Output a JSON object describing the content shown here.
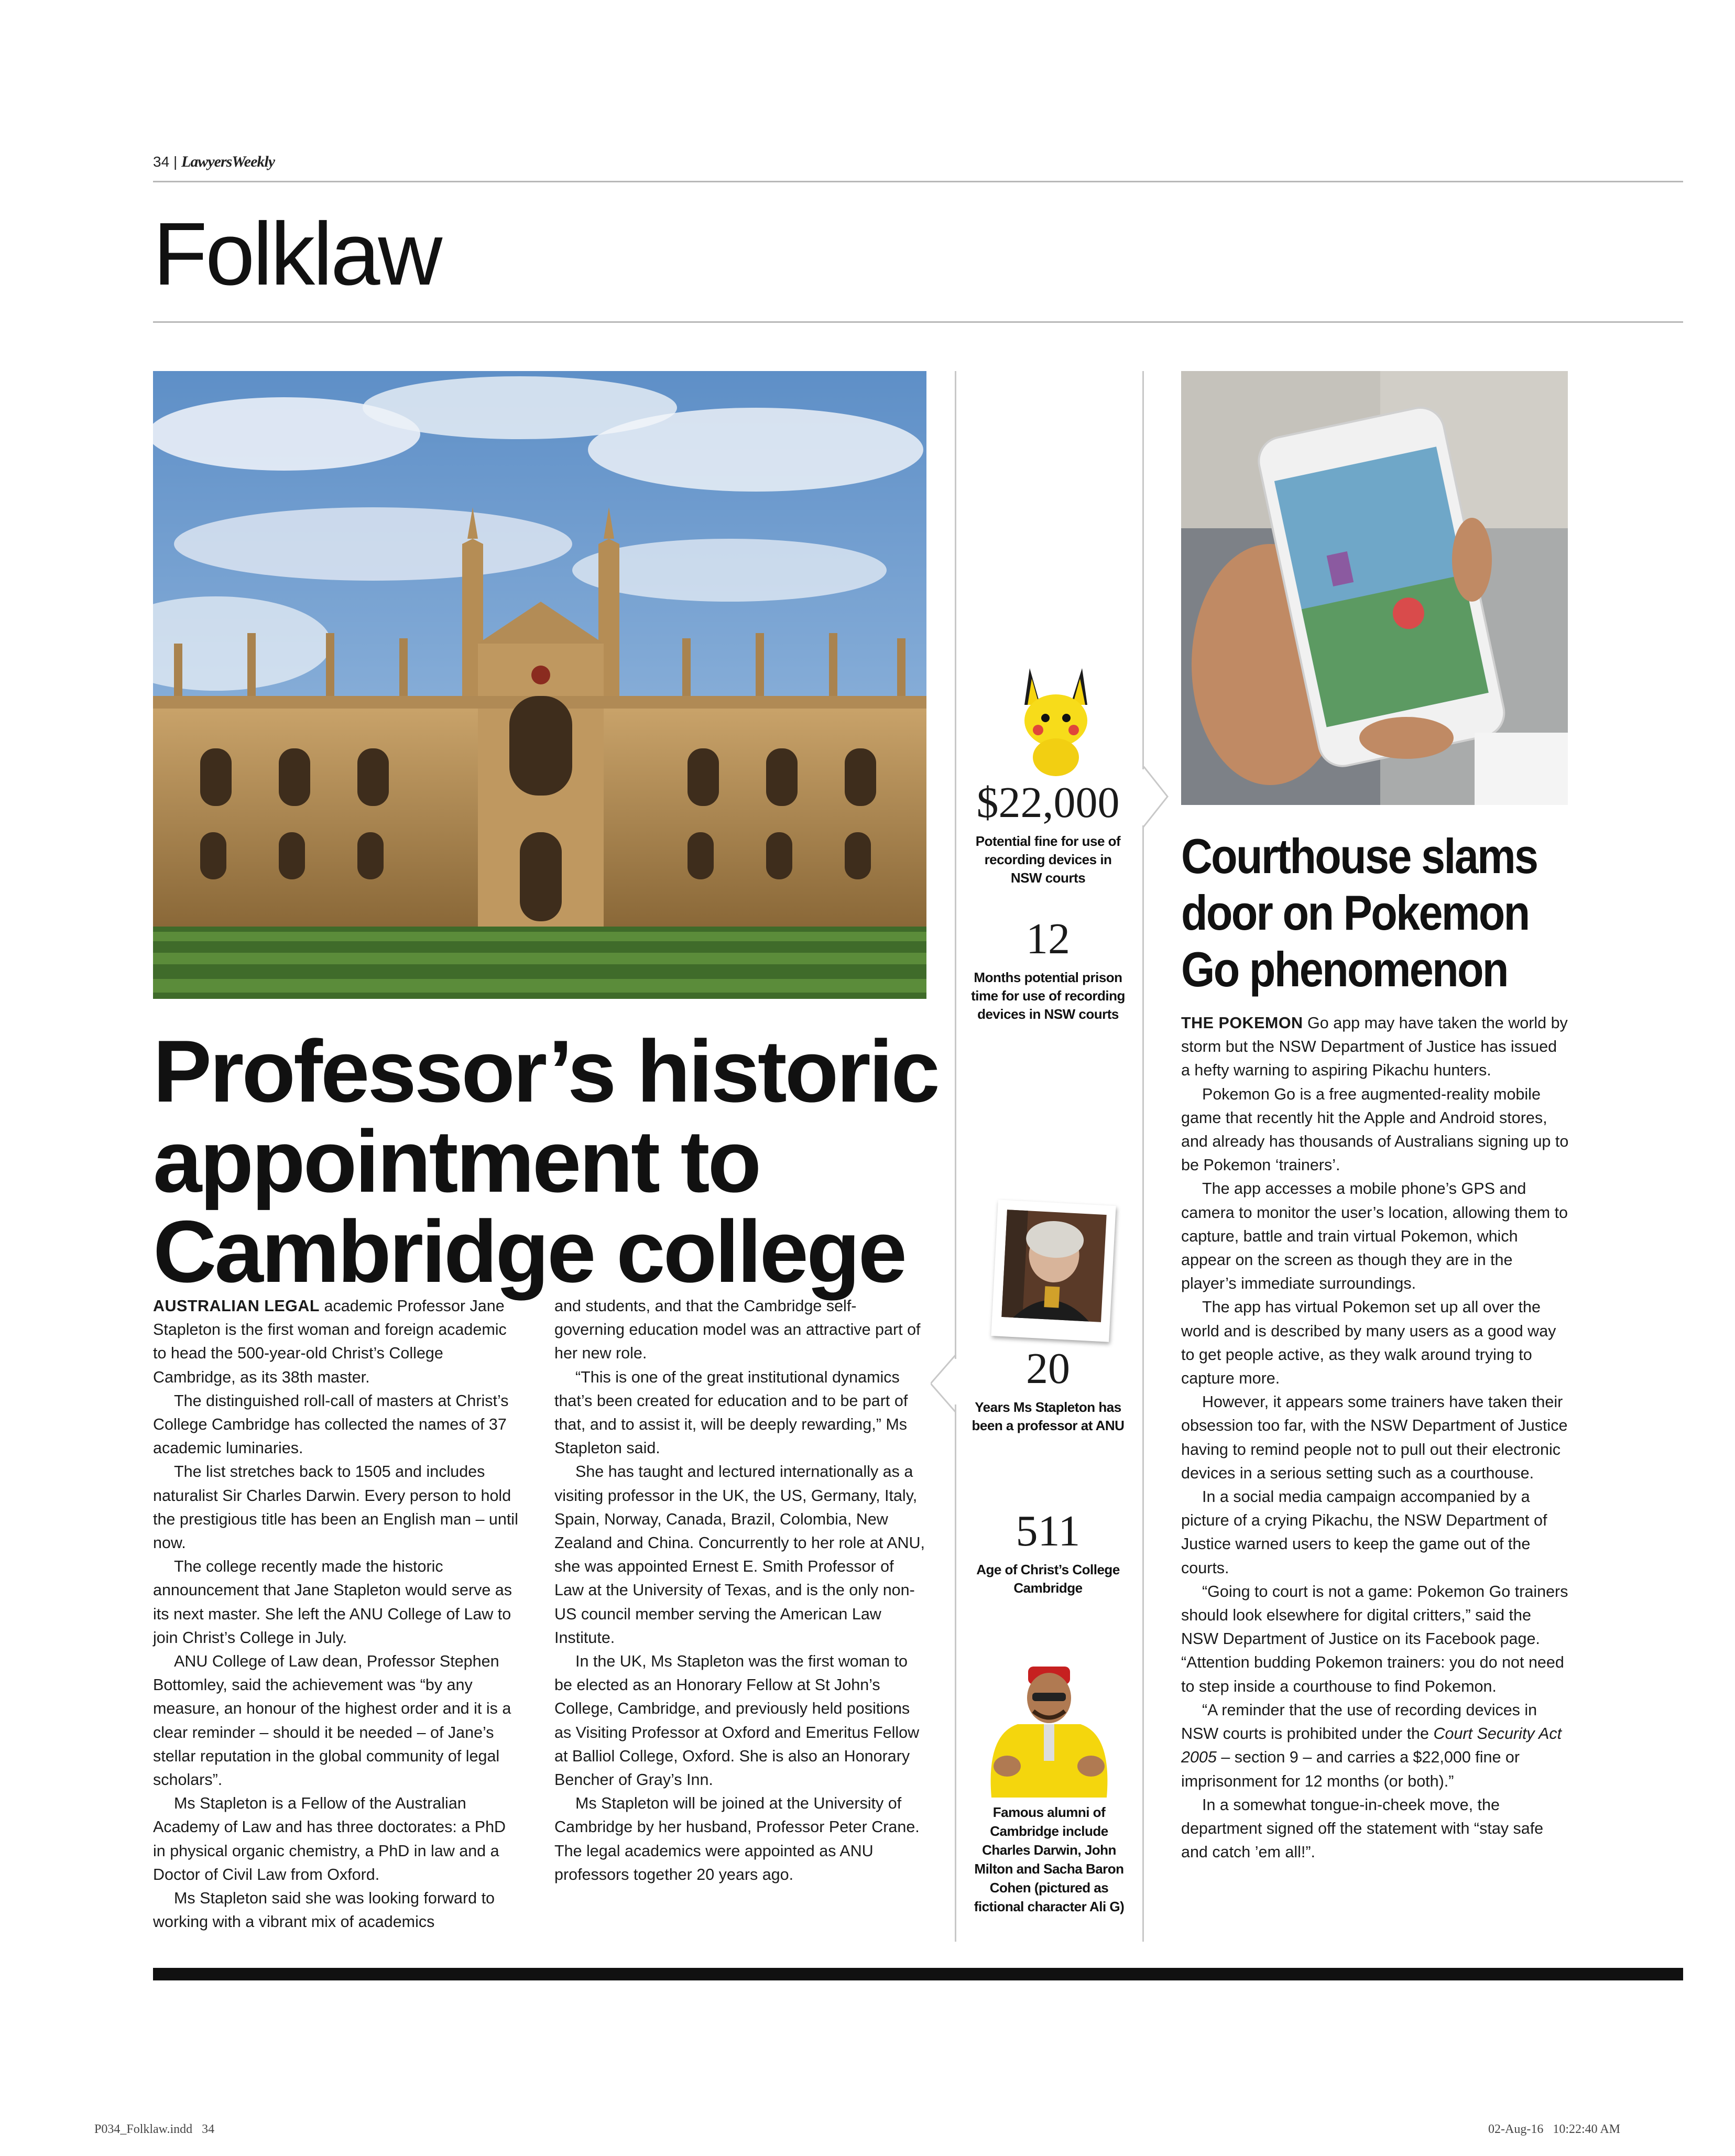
{
  "header": {
    "page_number": "34",
    "separator": "|",
    "brand": "LawyersWeekly",
    "section_title": "Folklaw"
  },
  "main_article": {
    "headline": "Professor’s historic appointment to Cambridge college",
    "lead_in": "AUSTRALIAN LEGAL",
    "column1": [
      " academic Professor Jane Stapleton is the first woman and foreign academic to head the 500-year-old Christ’s College Cambridge, as its 38th master.",
      "The distinguished roll-call of masters at Christ’s College Cambridge has collected the names of 37 academic luminaries.",
      "The list stretches back to 1505 and includes naturalist Sir Charles Darwin. Every person to hold the prestigious title has been an English man – until now.",
      "The college recently made the historic announcement that Jane Stapleton would serve as its next master. She left the ANU College of Law to join Christ’s College in July.",
      "ANU College of Law dean, Professor Stephen Bottomley, said the achievement was “by any measure, an honour of the highest order and it is a clear reminder – should it be needed – of Jane’s stellar reputation in the global community of legal scholars”.",
      "Ms Stapleton is a Fellow of the Australian Academy of Law and has three doctorates: a PhD in physical organic chemistry, a PhD in law and a Doctor of Civil Law from Oxford.",
      "Ms Stapleton said she was looking forward to working with a vibrant mix of academics"
    ],
    "column2": [
      "and students, and that the Cambridge self-governing education model was an attractive part of her new role.",
      "“This is one of the great institutional dynamics that’s been created for education and to be part of that, and to assist it, will be deeply rewarding,” Ms Stapleton said.",
      "She has taught and lectured internationally as a visiting professor in the UK, the US, Germany, Italy, Spain, Norway, Canada, Brazil, Colombia, New Zealand and China. Concurrently to her role at ANU, she was appointed Ernest E. Smith Professor of Law at the University of Texas, and is the only non-US council member serving the American Law Institute.",
      "In the UK, Ms Stapleton was the first woman to be elected as an Honorary Fellow at St John’s College, Cambridge, and previously held positions as Visiting Professor at Oxford and Emeritus Fellow at Balliol College, Oxford. She is also an Honorary Bencher of Gray’s Inn.",
      "Ms Stapleton will be joined at the University of Cambridge by her husband, Professor Peter Crane. The legal academics were appointed as ANU professors together 20 years ago."
    ]
  },
  "stats": {
    "fine": {
      "value": "$22,000",
      "label": "Potential fine for use of recording devices in NSW courts"
    },
    "prison": {
      "value": "12",
      "label": "Months potential prison time for use of recording devices in NSW courts"
    },
    "years": {
      "value": "20",
      "label": "Years Ms Stapleton has been a professor at ANU"
    },
    "age": {
      "value": "511",
      "label": "Age of Christ’s College Cambridge"
    },
    "alumni_caption": "Famous alumni of Cambridge include Charles Darwin, John Milton and Sacha Baron Cohen (pictured as fictional character Ali G)"
  },
  "side_article": {
    "headline": "Courthouse slams door on Pokemon Go phenomenon",
    "lead_in": "THE POKEMON",
    "p1": " Go app may have taken the world by storm but the NSW Department of Justice has issued a hefty warning to aspiring Pikachu hunters.",
    "p2": "Pokemon Go is a free augmented-reality mobile game that recently hit the Apple and Android stores, and already has thousands of Australians signing up to be Pokemon ‘trainers’.",
    "p3": "The app accesses a mobile phone’s GPS and camera to monitor the user’s location, allowing them to capture, battle and train virtual Pokemon, which appear on the screen as though they are in the player’s immediate surroundings.",
    "p4": "The app has virtual Pokemon set up all over the world and is described by many users as a good way to get people active, as they walk around trying to capture more.",
    "p5": "However, it appears some trainers have taken their obsession too far, with the NSW Department of Justice having to remind people not to pull out their electronic devices in a serious setting such as a courthouse.",
    "p6": "In a social media campaign accompanied by a picture of a crying Pikachu, the NSW Department of Justice warned users to keep the game out of the courts.",
    "p7": "“Going to court is not a game: Pokemon Go trainers should look elsewhere for digital critters,” said the NSW Department of Justice on its Facebook page. “Attention budding Pokemon trainers: you do not need to step inside a courthouse to find Pokemon.",
    "p8_a": "“A reminder that the use of recording devices in NSW courts is prohibited under the ",
    "p8_italic": "Court Security Act 2005",
    "p8_b": " – section 9 – and carries a $22,000 fine or imprisonment for 12 months (or both).”",
    "p9": "In a somewhat tongue-in-cheek move, the department signed off the statement with “stay safe and catch ’em all!”."
  },
  "footer": {
    "file": "P034_Folklaw.indd   34",
    "timestamp": "02-Aug-16   10:22:40 AM"
  }
}
